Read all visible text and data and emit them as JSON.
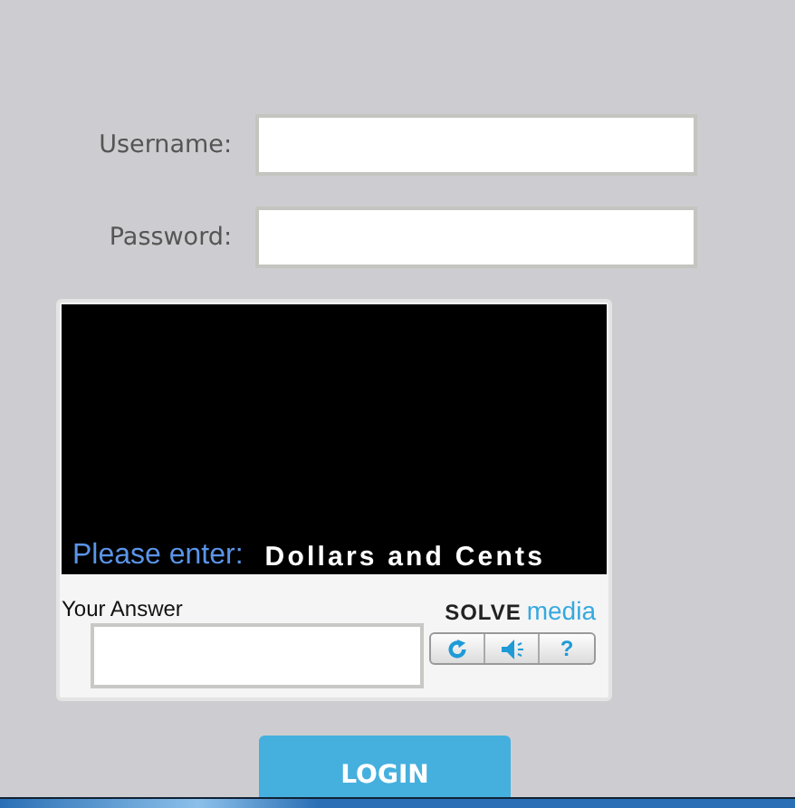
{
  "form": {
    "fields": [
      {
        "label": "Username:"
      },
      {
        "label": "Password:"
      }
    ]
  },
  "captcha": {
    "prompt": "Please enter:",
    "challenge": "Dollars and Cents",
    "answer_label": "Your Answer",
    "logo": {
      "first": "SOLVE",
      "second": "media"
    },
    "help_button": "?"
  },
  "login_button": "LOGIN"
}
